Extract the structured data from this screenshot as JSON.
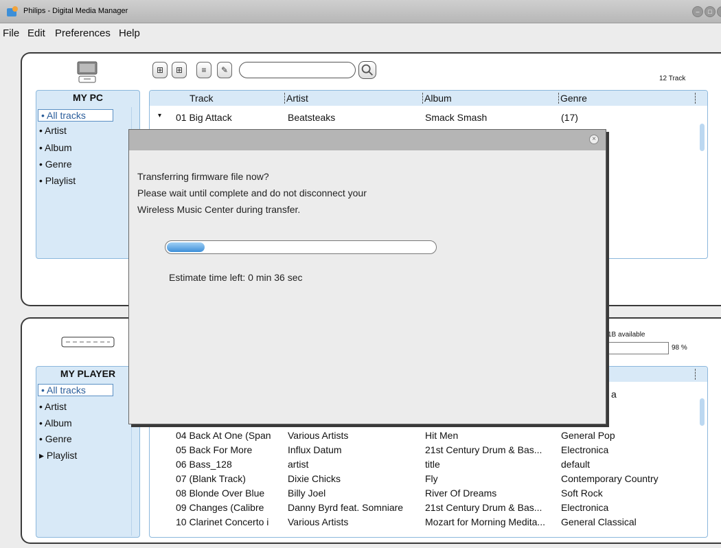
{
  "window": {
    "title": "Philips - Digital Media Manager"
  },
  "menu": [
    "File",
    "Edit",
    "Preferences",
    "Help"
  ],
  "colors": {
    "side_bg": "#d8e9f7",
    "accent": "#3d8fd8",
    "selected_border": "#5a8fc4"
  },
  "pc": {
    "heading": "MY PC",
    "nav": [
      "All tracks",
      "Artist",
      "Album",
      "Genre",
      "Playlist"
    ],
    "track_count": "12 Track",
    "columns": [
      "Track",
      "Artist",
      "Album",
      "Genre"
    ],
    "rows": [
      {
        "track": "01  Big Attack",
        "artist": "Beatsteaks",
        "album": "Smack Smash",
        "genre": "(17)"
      }
    ]
  },
  "player": {
    "heading": "MY PLAYER",
    "nav": [
      "All tracks",
      "Artist",
      "Album",
      "Genre",
      "Playlist"
    ],
    "available": "1B available",
    "capacity_percent": "98 %",
    "capacity_fraction": 0.98,
    "genre_partial": "a",
    "rows": [
      {
        "track": "04  Back At One (Span",
        "artist": "Various Artists",
        "album": "Hit Men",
        "genre": "General Pop"
      },
      {
        "track": "05  Back For More",
        "artist": "Influx Datum",
        "album": "21st Century Drum & Bas...",
        "genre": "Electronica"
      },
      {
        "track": "06  Bass_128",
        "artist": "artist",
        "album": "title",
        "genre": "default"
      },
      {
        "track": "07  (Blank Track)",
        "artist": "Dixie Chicks",
        "album": "Fly",
        "genre": "Contemporary Country"
      },
      {
        "track": "08  Blonde Over Blue",
        "artist": "Billy Joel",
        "album": "River Of Dreams",
        "genre": "Soft Rock"
      },
      {
        "track": "09  Changes (Calibre",
        "artist": "Danny Byrd feat. Somniare",
        "album": "21st Century Drum & Bas...",
        "genre": "Electronica"
      },
      {
        "track": "10  Clarinet Concerto i",
        "artist": "Various Artists",
        "album": "Mozart for Morning Medita...",
        "genre": "General Classical"
      }
    ]
  },
  "dialog": {
    "lines": [
      "Transferring firmware file now?",
      "Please wait until complete and do not disconnect your",
      "Wireless Music Center during transfer."
    ],
    "progress_fraction": 0.14,
    "estimate": "Estimate time left: 0 min 36 sec"
  },
  "icons": [
    "app-icon",
    "computer-icon",
    "add-file-icon",
    "add-folder-icon",
    "edit-icon",
    "attach-icon",
    "search-icon",
    "device-icon",
    "close-icon"
  ]
}
